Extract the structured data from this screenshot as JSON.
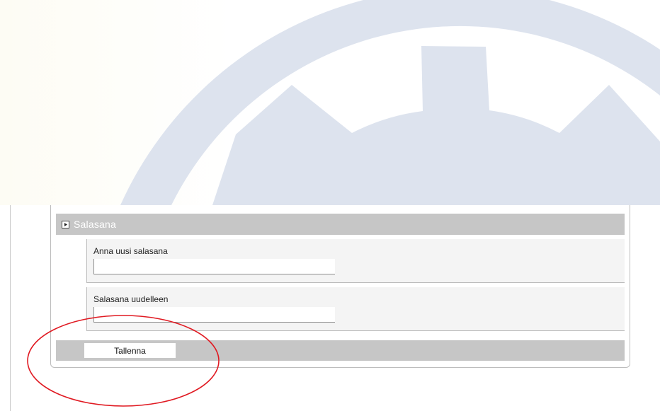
{
  "colors": {
    "gear": "#dde3ee",
    "section_header": "#c6c6c6",
    "field_background": "#f4f4f4",
    "annotation": "#e01a22"
  },
  "section": {
    "title": "Salasana",
    "expand_icon": "expand-triangle-icon"
  },
  "fields": [
    {
      "label": "Anna uusi salasana",
      "value": ""
    },
    {
      "label": "Salasana uudelleen",
      "value": ""
    }
  ],
  "footer": {
    "save_label": "Tallenna"
  }
}
